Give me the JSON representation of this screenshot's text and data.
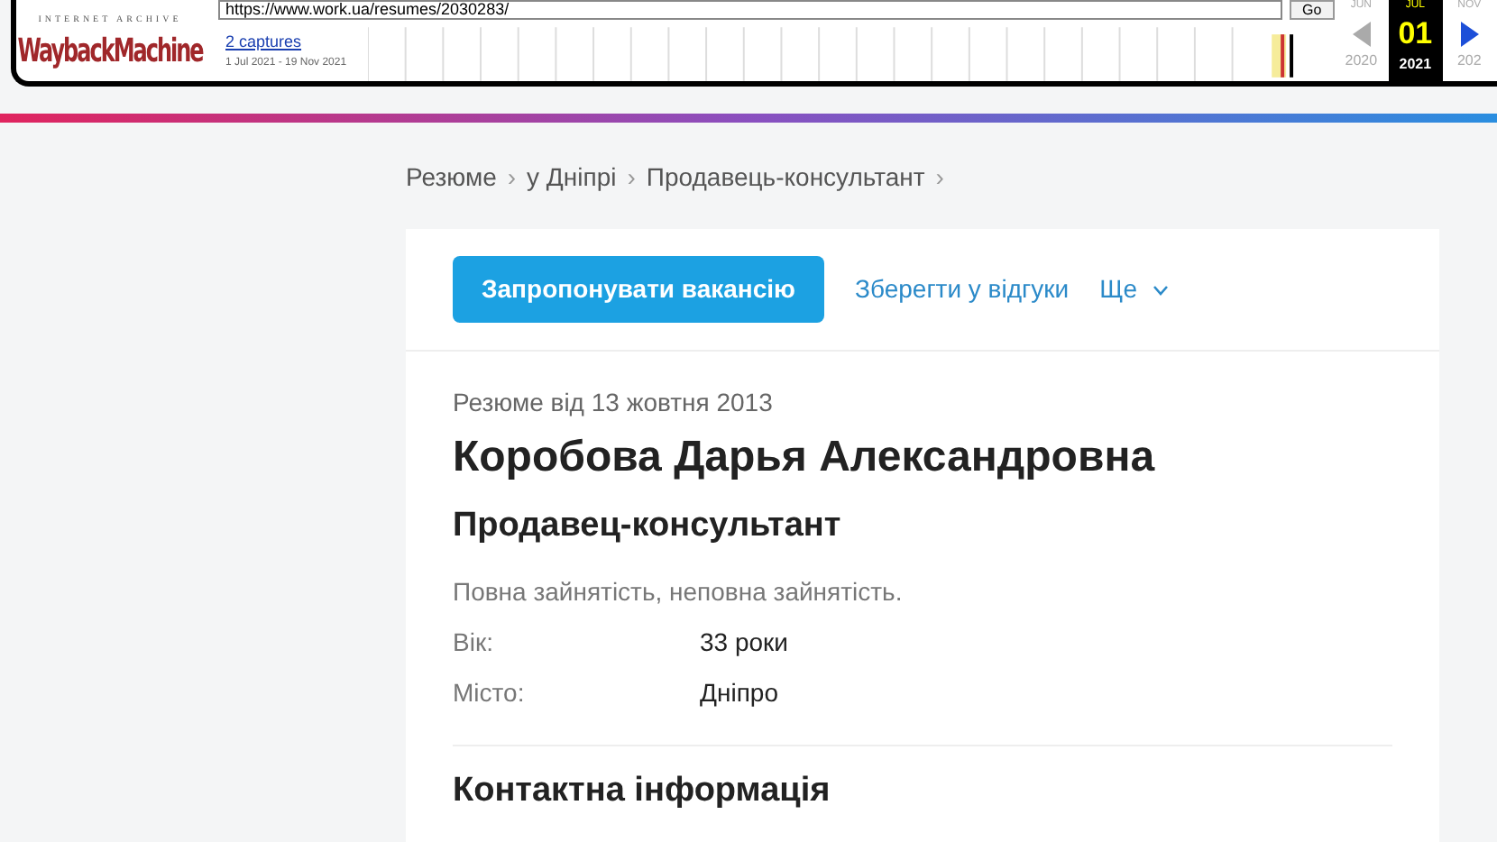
{
  "wayback_toolbar": {
    "logo_top": "INTERNET ARCHIVE",
    "logo": "WaybackMachine",
    "url": "https://www.work.ua/resumes/2030283/",
    "go_button": "Go",
    "captures_link": "2 captures",
    "capture_range": "1 Jul 2021 - 19 Nov 2021",
    "months": [
      {
        "label": "JUN",
        "selected": false
      },
      {
        "label": "JUL",
        "selected": true
      },
      {
        "label": "NOV",
        "selected": false
      }
    ],
    "day": "01",
    "years": [
      {
        "label": "2020",
        "selected": false
      },
      {
        "label": "2021",
        "selected": true
      },
      {
        "label": "202",
        "selected": false
      }
    ]
  },
  "breadcrumbs": {
    "separator": "›",
    "items": [
      "Резюме",
      "у Дніпрі",
      "Продавець-консультант"
    ]
  },
  "actions": {
    "primary": "Запропонувати вакансію",
    "save": "Зберегти у відгуки",
    "more": "Ще"
  },
  "resume": {
    "date": "Резюме від 13 жовтня 2013",
    "name": "Коробова Дарья Александровна",
    "position": "Продавец-консультант",
    "employment": "Повна зайнятість, неповна зайнятість.",
    "details": [
      {
        "label": "Вік:",
        "value": "33 роки"
      },
      {
        "label": "Місто:",
        "value": "Дніпро"
      }
    ]
  },
  "contact_heading": "Контактна інформація"
}
